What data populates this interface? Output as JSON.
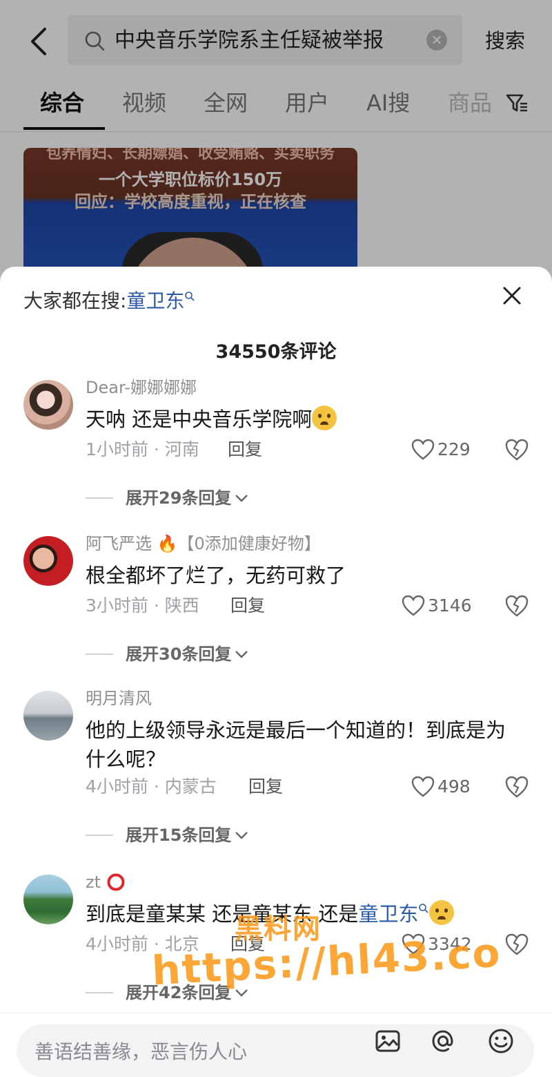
{
  "search": {
    "query": "中央音乐学院系主任疑被举报",
    "clear_label": "✕",
    "submit_label": "搜索"
  },
  "tabs": [
    {
      "label": "综合",
      "active": true
    },
    {
      "label": "视频"
    },
    {
      "label": "全网"
    },
    {
      "label": "用户"
    },
    {
      "label": "AI搜"
    },
    {
      "label": "商品"
    }
  ],
  "video_thumb": {
    "line1": "包养情妇、长期嫖娼、收受贿赂、买卖职务",
    "line2": "一个大学职位标价150万",
    "line3": "回应：学校高度重视，正在核查"
  },
  "sheet": {
    "trending_prefix": "大家都在搜:",
    "trending_keyword": "童卫东",
    "comment_count": "34550条评论"
  },
  "comments": [
    {
      "username": "Dear-娜娜娜娜",
      "text": "天呐 还是中央音乐学院啊",
      "time_location": "1小时前 · 河南",
      "reply_label": "回复",
      "likes": "229",
      "expand": "展开29条回复"
    },
    {
      "username": "阿飞严选",
      "username_suffix": "【0添加健康好物】",
      "text": "根全都坏了烂了，无药可救了",
      "time_location": "3小时前 · 陕西",
      "reply_label": "回复",
      "likes": "3146",
      "expand": "展开30条回复"
    },
    {
      "username": "明月清风",
      "text": "他的上级领导永远是最后一个知道的！到底是为什么呢？",
      "time_location": "4小时前 · 内蒙古",
      "reply_label": "回复",
      "likes": "498",
      "expand": "展开15条回复"
    },
    {
      "username": "zt",
      "text_prefix": "到底是童某某 还是童某东 还是",
      "text_keyword": "童卫东",
      "time_location": "4小时前 · 北京",
      "reply_label": "回复",
      "likes": "3342",
      "expand": "展开42条回复"
    }
  ],
  "watermark": {
    "line1": "黑料网",
    "line2": "https://hl43.co"
  },
  "input_bar": {
    "placeholder": "善语结善缘，恶言伤人心"
  },
  "colors": {
    "link_blue": "#2c5aa8",
    "watermark_orange": "#fa9614"
  }
}
